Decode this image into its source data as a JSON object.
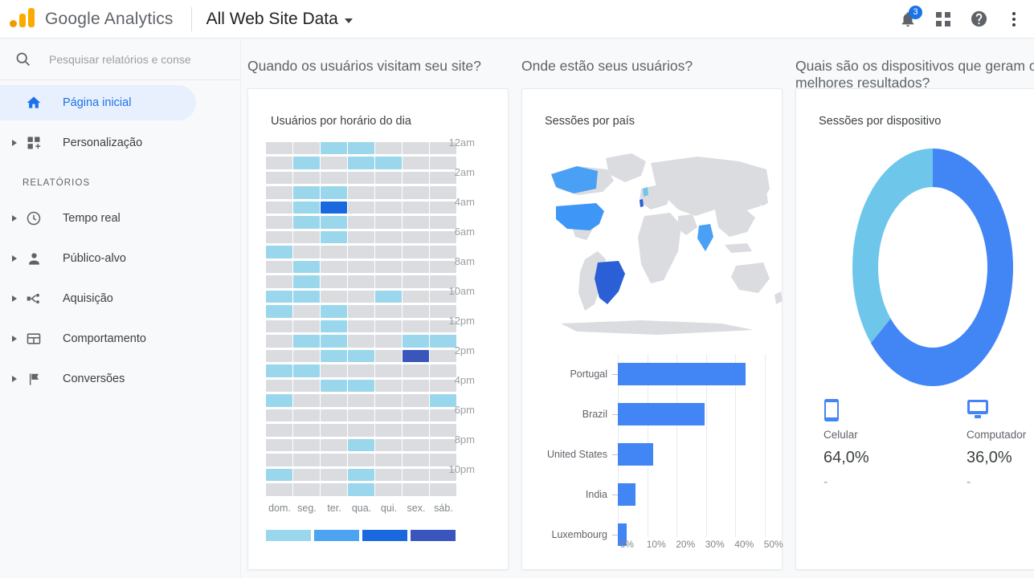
{
  "header": {
    "brand": "Google Analytics",
    "property": "All Web Site Data",
    "notifications_badge": "3",
    "icons": {
      "bell": "notifications-icon",
      "apps": "apps-grid-icon",
      "help": "help-icon",
      "more": "more-vertical-icon"
    }
  },
  "sidebar": {
    "search_placeholder": "Pesquisar relatórios e conse",
    "section_label": "RELATÓRIOS",
    "items": [
      {
        "label": "Página inicial",
        "icon": "home-icon",
        "active": true,
        "expandable": false
      },
      {
        "label": "Personalização",
        "icon": "customization-icon",
        "active": false,
        "expandable": true
      },
      {
        "label": "Tempo real",
        "icon": "clock-icon",
        "active": false,
        "expandable": true
      },
      {
        "label": "Público-alvo",
        "icon": "person-icon",
        "active": false,
        "expandable": true
      },
      {
        "label": "Aquisição",
        "icon": "acquisition-icon",
        "active": false,
        "expandable": true
      },
      {
        "label": "Comportamento",
        "icon": "behavior-icon",
        "active": false,
        "expandable": true
      },
      {
        "label": "Conversões",
        "icon": "flag-icon",
        "active": false,
        "expandable": true
      }
    ]
  },
  "cards": [
    {
      "question": "Quando os usuários visitam seu site?",
      "title": "Usuários por horário do dia"
    },
    {
      "question": "Onde estão seus usuários?",
      "title": "Sessões por país"
    },
    {
      "question": "Quais são os dispositivos que geram os melhores resultados?",
      "title": "Sessões por dispositivo"
    }
  ],
  "colors": {
    "accent": "#1a73e8",
    "bar_blue": "#4285f4",
    "heat_empty": "#dadce0",
    "heat_l1": "#9bd7ec",
    "heat_l2": "#4ba3f2",
    "heat_l3": "#1a68e0",
    "heat_l4": "#3a56bc",
    "donut_primary": "#4285f4",
    "donut_secondary": "#6ec6ea",
    "map_land": "#dadce0"
  },
  "chart_data": [
    {
      "type": "heatmap",
      "title": "Usuários por horário do dia",
      "xlabel": "",
      "ylabel": "",
      "categories": [
        "dom.",
        "seg.",
        "ter.",
        "qua.",
        "qui.",
        "sex.",
        "sáb."
      ],
      "hour_labels": [
        "12am",
        "2am",
        "4am",
        "6am",
        "8am",
        "10am",
        "12pm",
        "2pm",
        "4pm",
        "6pm",
        "8pm",
        "10pm"
      ],
      "legend_levels": [
        1,
        2,
        3,
        4
      ],
      "legend_colors": [
        "#9bd7ec",
        "#4ba3f2",
        "#1a68e0",
        "#3a56bc"
      ],
      "rows": 24,
      "cols": 7,
      "values": [
        [
          0,
          0,
          1,
          1,
          0,
          0,
          0
        ],
        [
          0,
          1,
          0,
          1,
          1,
          0,
          0
        ],
        [
          0,
          0,
          0,
          0,
          0,
          0,
          0
        ],
        [
          0,
          1,
          1,
          0,
          0,
          0,
          0
        ],
        [
          0,
          1,
          3,
          0,
          0,
          0,
          0
        ],
        [
          0,
          1,
          1,
          0,
          0,
          0,
          0
        ],
        [
          0,
          0,
          1,
          0,
          0,
          0,
          0
        ],
        [
          1,
          0,
          0,
          0,
          0,
          0,
          0
        ],
        [
          0,
          1,
          0,
          0,
          0,
          0,
          0
        ],
        [
          0,
          1,
          0,
          0,
          0,
          0,
          0
        ],
        [
          1,
          1,
          0,
          0,
          1,
          0,
          0
        ],
        [
          1,
          0,
          1,
          0,
          0,
          0,
          0
        ],
        [
          0,
          0,
          1,
          0,
          0,
          0,
          0
        ],
        [
          0,
          1,
          1,
          0,
          0,
          1,
          1
        ],
        [
          0,
          0,
          1,
          1,
          0,
          4,
          0
        ],
        [
          1,
          1,
          0,
          0,
          0,
          0,
          0
        ],
        [
          0,
          0,
          1,
          1,
          0,
          0,
          0
        ],
        [
          1,
          0,
          0,
          0,
          0,
          0,
          1
        ],
        [
          0,
          0,
          0,
          0,
          0,
          0,
          0
        ],
        [
          0,
          0,
          0,
          0,
          0,
          0,
          0
        ],
        [
          0,
          0,
          0,
          1,
          0,
          0,
          0
        ],
        [
          0,
          0,
          0,
          0,
          0,
          0,
          0
        ],
        [
          1,
          0,
          0,
          1,
          0,
          0,
          0
        ],
        [
          0,
          0,
          0,
          1,
          0,
          0,
          0
        ]
      ]
    },
    {
      "type": "bar",
      "orientation": "horizontal",
      "title": "Sessões por país",
      "categories": [
        "Portugal",
        "Brazil",
        "United States",
        "India",
        "Luxembourg"
      ],
      "values": [
        43.5,
        29.5,
        12.0,
        6.0,
        3.0
      ],
      "xlabel": "",
      "ylabel": "",
      "xlim": [
        0,
        50
      ],
      "tick_labels": [
        "0%",
        "10%",
        "20%",
        "30%",
        "40%",
        "50%"
      ],
      "grid": true,
      "map_highlight": [
        "Portugal",
        "Brazil",
        "United States",
        "India",
        "Luxembourg",
        "Canada"
      ]
    },
    {
      "type": "pie",
      "variant": "donut",
      "title": "Sessões por dispositivo",
      "categories": [
        "Celular",
        "Computador"
      ],
      "values": [
        64.0,
        36.0
      ],
      "labels": [
        "64,0%",
        "36,0%"
      ],
      "colors": [
        "#4285f4",
        "#6ec6ea"
      ],
      "legend_position": "bottom",
      "sublabels": [
        "-",
        "-"
      ]
    }
  ]
}
